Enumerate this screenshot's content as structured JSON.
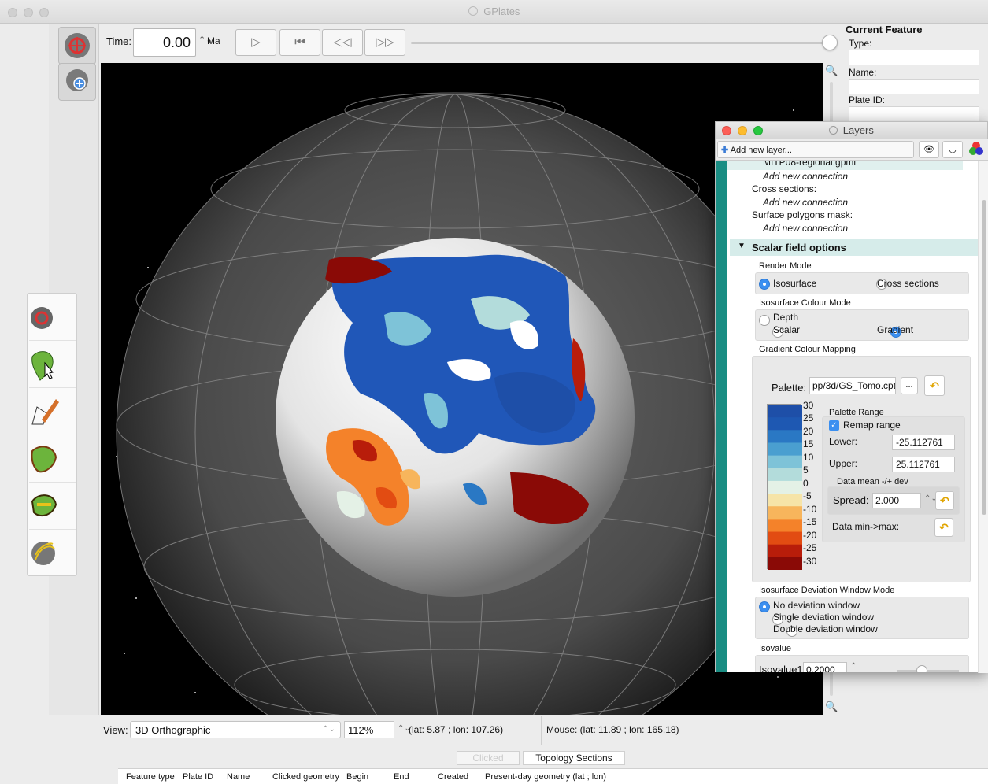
{
  "window": {
    "title": "GPlates"
  },
  "time_bar": {
    "label": "Time:",
    "value": "0.00",
    "unit": "Ma",
    "buttons": [
      "play",
      "reset-to-start",
      "step-back",
      "step-forward"
    ]
  },
  "current_feature": {
    "heading": "Current Feature",
    "type_label": "Type:",
    "name_label": "Name:",
    "plate_id_label": "Plate ID:"
  },
  "status": {
    "view_label": "View:",
    "projection": "3D Orthographic",
    "zoom": "112%",
    "camera": "(lat: 5.87 ; lon: 107.26)",
    "mouse": "Mouse: (lat: 11.89 ; lon: 165.18)"
  },
  "bottom_tabs": {
    "tab_clicked": "Clicked",
    "tab_topology": "Topology Sections"
  },
  "table_headers": [
    "Feature type",
    "Plate ID",
    "Name",
    "Clicked geometry",
    "Begin",
    "End",
    "Created",
    "Present-day geometry (lat ; lon)"
  ],
  "layers": {
    "title": "Layers",
    "add_layer": "Add new layer...",
    "file": "MITP08-regional.gpml",
    "add_connection": "Add new connection",
    "cross_sections_label": "Cross sections:",
    "add_connection_2": "Add new connection",
    "surface_mask_label": "Surface polygons mask:",
    "add_connection_3": "Add new connection",
    "section_title": "Scalar field options",
    "render_mode": {
      "label": "Render Mode",
      "opt1": "Isosurface",
      "opt2": "Cross sections",
      "selected": "Isosurface"
    },
    "colour_mode": {
      "label": "Isosurface Colour Mode",
      "opt_depth": "Depth",
      "opt_scalar": "Scalar",
      "opt_gradient": "Gradient",
      "selected": "Gradient"
    },
    "gradient_mapping": {
      "label": "Gradient Colour Mapping",
      "palette_label": "Palette:",
      "palette_value": "pp/3d/GS_Tomo.cpt",
      "browse": "...",
      "palette_range_label": "Palette Range",
      "remap_label": "Remap range",
      "remap_checked": true,
      "lower_label": "Lower:",
      "lower_value": "-25.112761",
      "upper_label": "Upper:",
      "upper_value": "25.112761",
      "mean_dev_label": "Data mean -/+ dev",
      "spread_label": "Spread:",
      "spread_value": "2.000",
      "minmax_label": "Data min->max:",
      "scale_ticks": [
        "30",
        "25",
        "20",
        "15",
        "10",
        "5",
        "0",
        "-5",
        "-10",
        "-15",
        "-20",
        "-25",
        "-30"
      ],
      "scale_colors": [
        "#1e4fa8",
        "#1e58b2",
        "#2a78c4",
        "#4a9fd0",
        "#7ec3d8",
        "#b3dcdb",
        "#e4f1e6",
        "#f6e4a8",
        "#f7b55c",
        "#f4822a",
        "#e24c12",
        "#b81d0a",
        "#8a0a06"
      ]
    },
    "deviation": {
      "label": "Isosurface Deviation Window Mode",
      "opt_none": "No deviation window",
      "opt_single": "Single deviation window",
      "opt_double": "Double deviation window",
      "selected": "No deviation window"
    },
    "isovalue": {
      "label": "Isovalue",
      "field_label": "Isovalue1",
      "value": "0.2000"
    }
  },
  "colors": {
    "accent": "#3b8ff0",
    "teal": "#1a8d83",
    "section_bg": "#d6ecea"
  }
}
